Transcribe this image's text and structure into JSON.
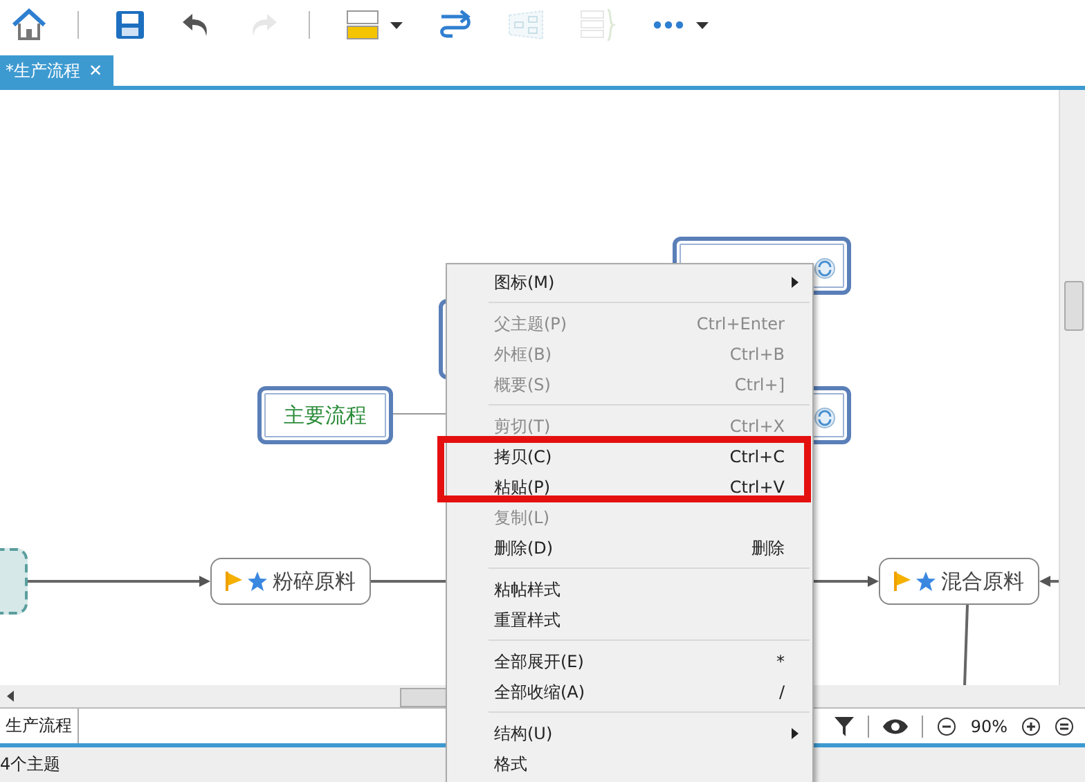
{
  "toolbar": [
    {
      "kind": "home",
      "disabled": false
    },
    {
      "kind": "sep"
    },
    {
      "kind": "save",
      "disabled": false
    },
    {
      "kind": "undo",
      "disabled": false
    },
    {
      "kind": "redo",
      "disabled": true
    },
    {
      "kind": "sep"
    },
    {
      "kind": "topic",
      "disabled": false
    },
    {
      "kind": "relation",
      "disabled": false
    },
    {
      "kind": "boundary",
      "disabled": true
    },
    {
      "kind": "summary",
      "disabled": true
    },
    {
      "kind": "more",
      "disabled": false
    }
  ],
  "tabs": [
    {
      "label": "*生产流程",
      "selected": true,
      "close": "✕"
    }
  ],
  "nodes": [
    {
      "kind": "framed",
      "linked": true
    },
    {
      "kind": "framed"
    },
    {
      "kind": "framed",
      "linked": true
    },
    {
      "kind": "framed",
      "text": "主要流程",
      "linked": false
    },
    {
      "kind": "dashed"
    },
    {
      "kind": "plain",
      "text": "粉碎原料",
      "flag": true,
      "star": true,
      "linked": false
    },
    {
      "kind": "plain",
      "text": "混合原料",
      "flag": true,
      "star": true,
      "linked": false
    }
  ],
  "context_menu": [
    {
      "kind": "item",
      "label": "图标(M)",
      "disabled": false,
      "submenu": true
    },
    {
      "kind": "separator"
    },
    {
      "kind": "item",
      "label": "父主题(P)",
      "shortcut": "Ctrl+Enter",
      "disabled": true,
      "submenu": false
    },
    {
      "kind": "item",
      "label": "外框(B)",
      "shortcut": "Ctrl+B",
      "disabled": true,
      "submenu": false
    },
    {
      "kind": "item",
      "label": "概要(S)",
      "shortcut": "Ctrl+]",
      "disabled": true,
      "submenu": false
    },
    {
      "kind": "separator"
    },
    {
      "kind": "item",
      "label": "剪切(T)",
      "shortcut": "Ctrl+X",
      "disabled": true,
      "submenu": false
    },
    {
      "kind": "item",
      "label": "拷贝(C)",
      "shortcut": "Ctrl+C",
      "disabled": false,
      "submenu": false
    },
    {
      "kind": "item",
      "label": "粘贴(P)",
      "shortcut": "Ctrl+V",
      "disabled": false,
      "submenu": false
    },
    {
      "kind": "item",
      "label": "复制(L)",
      "disabled": true,
      "submenu": false
    },
    {
      "kind": "item",
      "label": "删除(D)",
      "shortcut": "删除",
      "disabled": false,
      "submenu": false
    },
    {
      "kind": "separator"
    },
    {
      "kind": "item",
      "label": "粘帖样式",
      "disabled": false,
      "submenu": false
    },
    {
      "kind": "item",
      "label": "重置样式",
      "disabled": false,
      "submenu": false
    },
    {
      "kind": "separator"
    },
    {
      "kind": "item",
      "label": "全部展开(E)",
      "shortcut": "*",
      "disabled": false,
      "submenu": false
    },
    {
      "kind": "item",
      "label": "全部收缩(A)",
      "shortcut": "/",
      "disabled": false,
      "submenu": false
    },
    {
      "kind": "separator"
    },
    {
      "kind": "item",
      "label": "结构(U)",
      "disabled": false,
      "submenu": true
    },
    {
      "kind": "item",
      "label": "格式",
      "disabled": false,
      "submenu": false
    }
  ],
  "sheet_tabs": [
    {
      "label": "生产流程",
      "selected": true
    }
  ],
  "zoom": {
    "value": "90%"
  },
  "status_bar": {
    "text": "4个主题"
  }
}
